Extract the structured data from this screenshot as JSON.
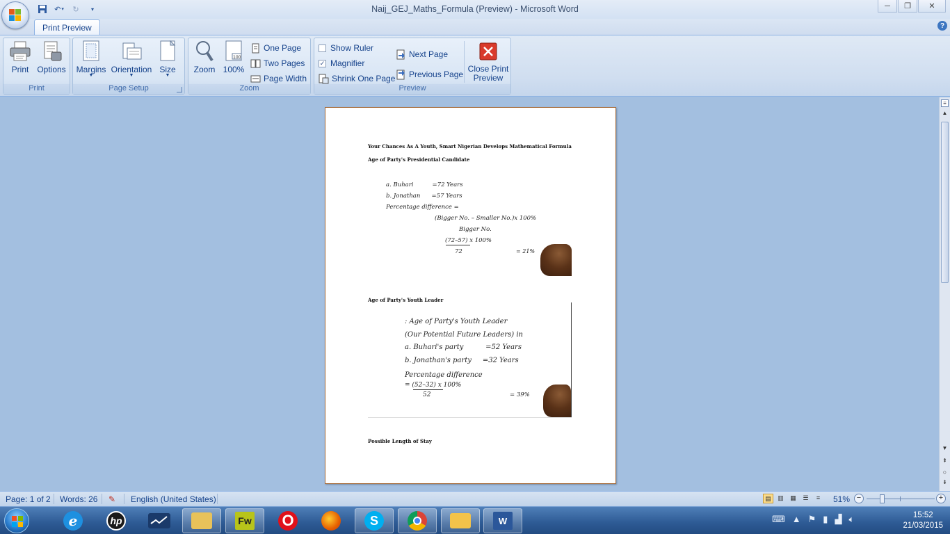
{
  "window": {
    "title": "Naij_GEJ_Maths_Formula (Preview) - Microsoft Word",
    "minimize": "─",
    "maximize": "❐",
    "close": "✕"
  },
  "tab": {
    "label": "Print Preview"
  },
  "help": "?",
  "groups": {
    "print": {
      "label": "Print",
      "print_btn": "Print",
      "options_btn": "Options"
    },
    "page_setup": {
      "label": "Page Setup",
      "margins_btn": "Margins",
      "orientation_btn": "Orientation",
      "size_btn": "Size"
    },
    "zoom": {
      "label": "Zoom",
      "zoom_btn": "Zoom",
      "hundred_btn": "100%",
      "one_page": "One Page",
      "two_pages": "Two Pages",
      "page_width": "Page Width"
    },
    "preview": {
      "label": "Preview",
      "show_ruler": "Show Ruler",
      "show_ruler_checked": false,
      "magnifier": "Magnifier",
      "magnifier_checked": true,
      "shrink_one_page": "Shrink One Page",
      "next_page": "Next Page",
      "previous_page": "Previous Page",
      "close_line1": "Close Print",
      "close_line2": "Preview"
    }
  },
  "document": {
    "heading": "Your Chances As A Youth, Smart Nigerian Develops Mathematical Formula",
    "section1": "Age of Party's Presidential Candidate",
    "s1_lines": [
      "a. Buhari          =72 Years",
      "b. Jonathan      =57 Years",
      "Percentage difference ="
    ],
    "s1_formula_top": "(Bigger No. – Smaller No.)x  100%",
    "s1_formula_bottom": "Bigger No.",
    "s1_calc_top": "(72–57)  x 100%",
    "s1_calc_bottom": "72",
    "s1_result": "= 21%",
    "section2": "Age of Party's Youth Leader",
    "s2_lines": [
      ": Age of Party's Youth Leader",
      "(Our Potential Future Leaders) in",
      "a. Buhari's party          =52 Years",
      "b. Jonathan's party     =32 Years",
      "Percentage difference"
    ],
    "s2_calc_top": "= (52–32)  x 100%",
    "s2_calc_bottom": "52",
    "s2_result": "= 39%",
    "section3": "Possible Length of Stay"
  },
  "status": {
    "page": "Page: 1 of 2",
    "words": "Words: 26",
    "language": "English (United States)",
    "zoom": "51%"
  },
  "taskbar": {
    "apps": [
      "start-orb",
      "internet-explorer",
      "hp",
      "stocks",
      "file-explorer",
      "fireworks",
      "opera",
      "firefox",
      "skype",
      "chrome",
      "outlook",
      "word"
    ],
    "fw_label": "Fw",
    "time": "15:52",
    "date": "21/03/2015"
  }
}
